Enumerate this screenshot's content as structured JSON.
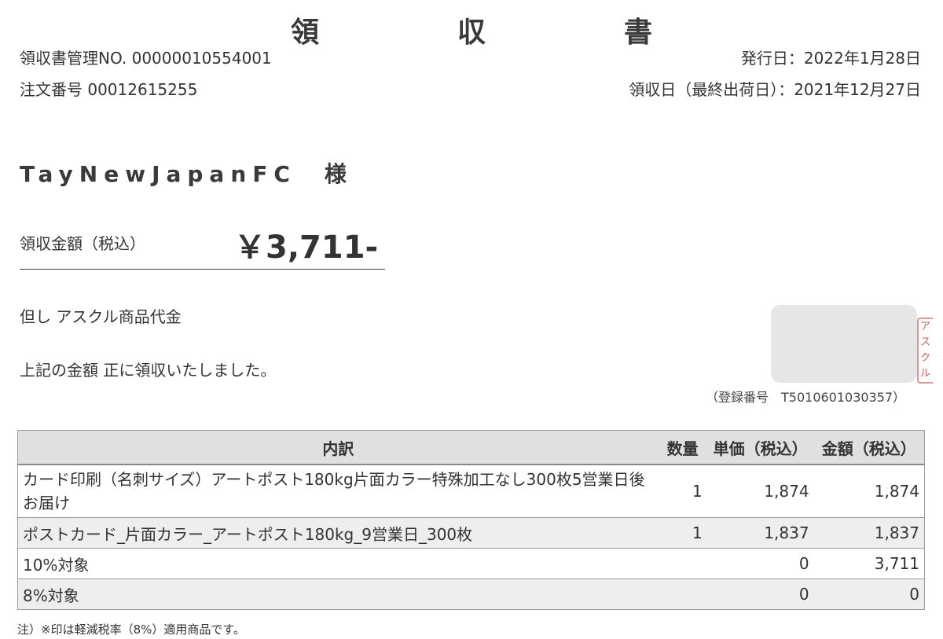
{
  "document": {
    "title": "領　収　書",
    "management_no": "領収書管理NO. 00000010554001",
    "order_no": "注文番号 00012615255",
    "issue_date": "発行日：2022年1月28日",
    "receipt_date": "領収日（最終出荷日）：2021年12月27日",
    "customer": "TayNewJapanFC　様",
    "amount_label": "領収金額（税込）",
    "amount": "￥3,711-",
    "proviso": "但し アスクル商品代金",
    "received_text": "上記の金額 正に領収いたしました。",
    "registration_no": "（登録番号　T5010601030357）",
    "seal_chars": [
      "ア",
      "ス",
      "ク",
      "ル"
    ]
  },
  "table": {
    "headers": {
      "desc": "内訳",
      "qty": "数量",
      "unit": "単価（税込）",
      "total": "金額（税込）"
    },
    "rows": [
      {
        "desc": "カード印刷（名刺サイズ）アートポスト180kg片面カラー特殊加工なし300枚5営業日後お届け",
        "qty": "1",
        "unit": "1,874",
        "total": "1,874"
      },
      {
        "desc": "ポストカード_片面カラー_アートポスト180kg_9営業日_300枚",
        "qty": "1",
        "unit": "1,837",
        "total": "1,837"
      },
      {
        "desc": "10%対象",
        "qty": "",
        "unit": "0",
        "total": "3,711"
      },
      {
        "desc": "8%対象",
        "qty": "",
        "unit": "0",
        "total": "0"
      }
    ]
  },
  "footnote": "注）※印は軽減税率（8%）適用商品です。"
}
